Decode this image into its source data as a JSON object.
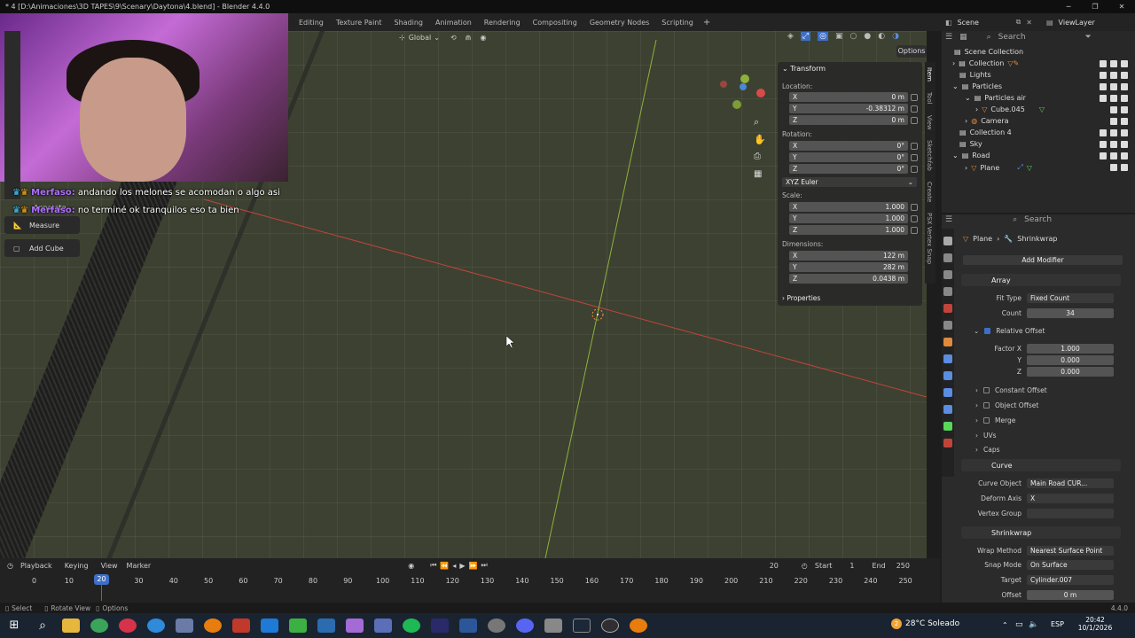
{
  "window": {
    "title": "* 4 [D:\\Animaciones\\3D TAPES\\9\\Scenary\\Daytona\\4.blend] - Blender 4.4.0",
    "controls": [
      "─",
      "❐",
      "✕"
    ]
  },
  "workspaces": [
    "Editing",
    "Texture Paint",
    "Shading",
    "Animation",
    "Rendering",
    "Compositing",
    "Geometry Nodes",
    "Scripting"
  ],
  "workspace_add": "+",
  "top_right": {
    "scene": "Scene",
    "view_layer": "ViewLayer"
  },
  "viewport_header": {
    "orientation": "Global",
    "options_label": "Options"
  },
  "chat": [
    {
      "user": "Merfaso:",
      "text": "andando los melones se acomodan o algo asi"
    },
    {
      "user": "Merfaso:",
      "text": "no terminé ok tranquilos eso ta bien"
    }
  ],
  "tools": {
    "annotate": "Annotate",
    "measure": "Measure",
    "add_cube": "Add Cube"
  },
  "transform": {
    "title": "Transform",
    "location_label": "Location:",
    "location": [
      {
        "axis": "X",
        "value": "0 m"
      },
      {
        "axis": "Y",
        "value": "-0.38312 m"
      },
      {
        "axis": "Z",
        "value": "0 m"
      }
    ],
    "rotation_label": "Rotation:",
    "rotation": [
      {
        "axis": "X",
        "value": "0°"
      },
      {
        "axis": "Y",
        "value": "0°"
      },
      {
        "axis": "Z",
        "value": "0°"
      }
    ],
    "rotation_mode": "XYZ Euler",
    "scale_label": "Scale:",
    "scale": [
      {
        "axis": "X",
        "value": "1.000"
      },
      {
        "axis": "Y",
        "value": "1.000"
      },
      {
        "axis": "Z",
        "value": "1.000"
      }
    ],
    "dimensions_label": "Dimensions:",
    "dimensions": [
      {
        "axis": "X",
        "value": "122 m"
      },
      {
        "axis": "Y",
        "value": "282 m"
      },
      {
        "axis": "Z",
        "value": "0.0438 m"
      }
    ],
    "properties": "Properties"
  },
  "npanel_tabs": [
    "Item",
    "Tool",
    "View",
    "Sketchfab",
    "Create",
    "PSX Vertex Snap"
  ],
  "outliner": {
    "search": "Search",
    "items": [
      {
        "label": "Scene Collection"
      },
      {
        "label": "Collection"
      },
      {
        "label": "Lights"
      },
      {
        "label": "Particles"
      },
      {
        "label": "Particles air"
      },
      {
        "label": "Cube.045"
      },
      {
        "label": "Camera"
      },
      {
        "label": "Collection 4"
      },
      {
        "label": "Sky"
      },
      {
        "label": "Road"
      },
      {
        "label": "Plane"
      }
    ]
  },
  "properties": {
    "search": "Search",
    "breadcrumb": {
      "object": "Plane",
      "modifier": "Shrinkwrap"
    },
    "add_modifier": "Add Modifier",
    "array": {
      "name": "Array",
      "fit_type_label": "Fit Type",
      "fit_type": "Fixed Count",
      "count_label": "Count",
      "count": "34",
      "relative_offset": "Relative Offset",
      "factor_x_label": "Factor X",
      "factor_x": "1.000",
      "y_label": "Y",
      "y": "0.000",
      "z_label": "Z",
      "z": "0.000",
      "constant_offset": "Constant Offset",
      "object_offset": "Object Offset",
      "merge": "Merge",
      "uvs": "UVs",
      "caps": "Caps"
    },
    "curve": {
      "name": "Curve",
      "curve_object_label": "Curve Object",
      "curve_object": "Main Road CUR...",
      "deform_axis_label": "Deform Axis",
      "deform_axis": "X",
      "vertex_group_label": "Vertex Group"
    },
    "shrinkwrap": {
      "name": "Shrinkwrap",
      "wrap_method_label": "Wrap Method",
      "wrap_method": "Nearest Surface Point",
      "snap_mode_label": "Snap Mode",
      "snap_mode": "On Surface",
      "target_label": "Target",
      "target": "Cylinder.007",
      "offset_label": "Offset",
      "offset": "0 m"
    }
  },
  "timeline": {
    "menus": [
      "Playback",
      "Keying",
      "View",
      "Marker"
    ],
    "current_frame": "20",
    "start_label": "Start",
    "start": "1",
    "end_label": "End",
    "end": "250",
    "ticks": [
      "0",
      "10",
      "20",
      "30",
      "40",
      "50",
      "60",
      "70",
      "80",
      "90",
      "100",
      "110",
      "120",
      "130",
      "140",
      "150",
      "160",
      "170",
      "180",
      "190",
      "200",
      "210",
      "220",
      "230",
      "240",
      "250"
    ]
  },
  "statusbar": {
    "select": "Select",
    "rotate_view": "Rotate View",
    "options": "Options",
    "version": "4.4.0"
  },
  "taskbar": {
    "weather": "28°C  Soleado",
    "lang": "ESP",
    "time": "20:42",
    "date": "10/1/2026",
    "badge": "2"
  }
}
